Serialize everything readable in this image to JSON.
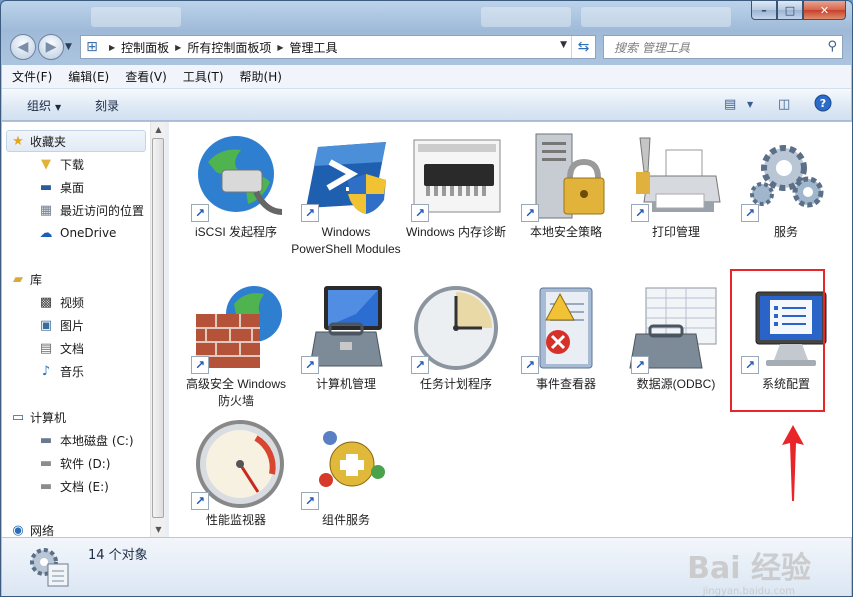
{
  "titlebar": {
    "min": "–",
    "max": "□",
    "close": "✕"
  },
  "address": {
    "crumbs": [
      "控制面板",
      "所有控制面板项",
      "管理工具"
    ],
    "search_placeholder": "搜索 管理工具"
  },
  "menu": [
    "文件(F)",
    "编辑(E)",
    "查看(V)",
    "工具(T)",
    "帮助(H)"
  ],
  "commands": {
    "organize": "组织",
    "burn": "刻录"
  },
  "nav": {
    "favorites": {
      "label": "收藏夹",
      "items": [
        "下载",
        "桌面",
        "最近访问的位置",
        "OneDrive"
      ]
    },
    "libraries": {
      "label": "库",
      "items": [
        "视频",
        "图片",
        "文档",
        "音乐"
      ]
    },
    "computer": {
      "label": "计算机",
      "items": [
        "本地磁盘 (C:)",
        "软件 (D:)",
        "文档 (E:)"
      ]
    },
    "network": {
      "label": "网络"
    }
  },
  "tiles": [
    {
      "label": "iSCSI 发起程序",
      "icon": "globe-network-icon"
    },
    {
      "label": "Windows PowerShell Modules",
      "icon": "powershell-icon"
    },
    {
      "label": "Windows 内存诊断",
      "icon": "memory-chip-icon"
    },
    {
      "label": "本地安全策略",
      "icon": "server-lock-icon"
    },
    {
      "label": "打印管理",
      "icon": "printer-icon"
    },
    {
      "label": "服务",
      "icon": "gears-icon"
    },
    {
      "label": "高级安全 Windows 防火墙",
      "icon": "firewall-icon"
    },
    {
      "label": "计算机管理",
      "icon": "computer-toolbox-icon"
    },
    {
      "label": "任务计划程序",
      "icon": "clock-icon"
    },
    {
      "label": "事件查看器",
      "icon": "event-log-icon"
    },
    {
      "label": "数据源(ODBC)",
      "icon": "database-toolbox-icon"
    },
    {
      "label": "系统配置",
      "icon": "monitor-checklist-icon"
    },
    {
      "label": "性能监视器",
      "icon": "gauge-icon"
    },
    {
      "label": "组件服务",
      "icon": "components-icon"
    }
  ],
  "status": {
    "count": "14 个对象"
  },
  "watermark": {
    "main": "Bai 经验",
    "sub": "jingyan.baidu.com"
  }
}
